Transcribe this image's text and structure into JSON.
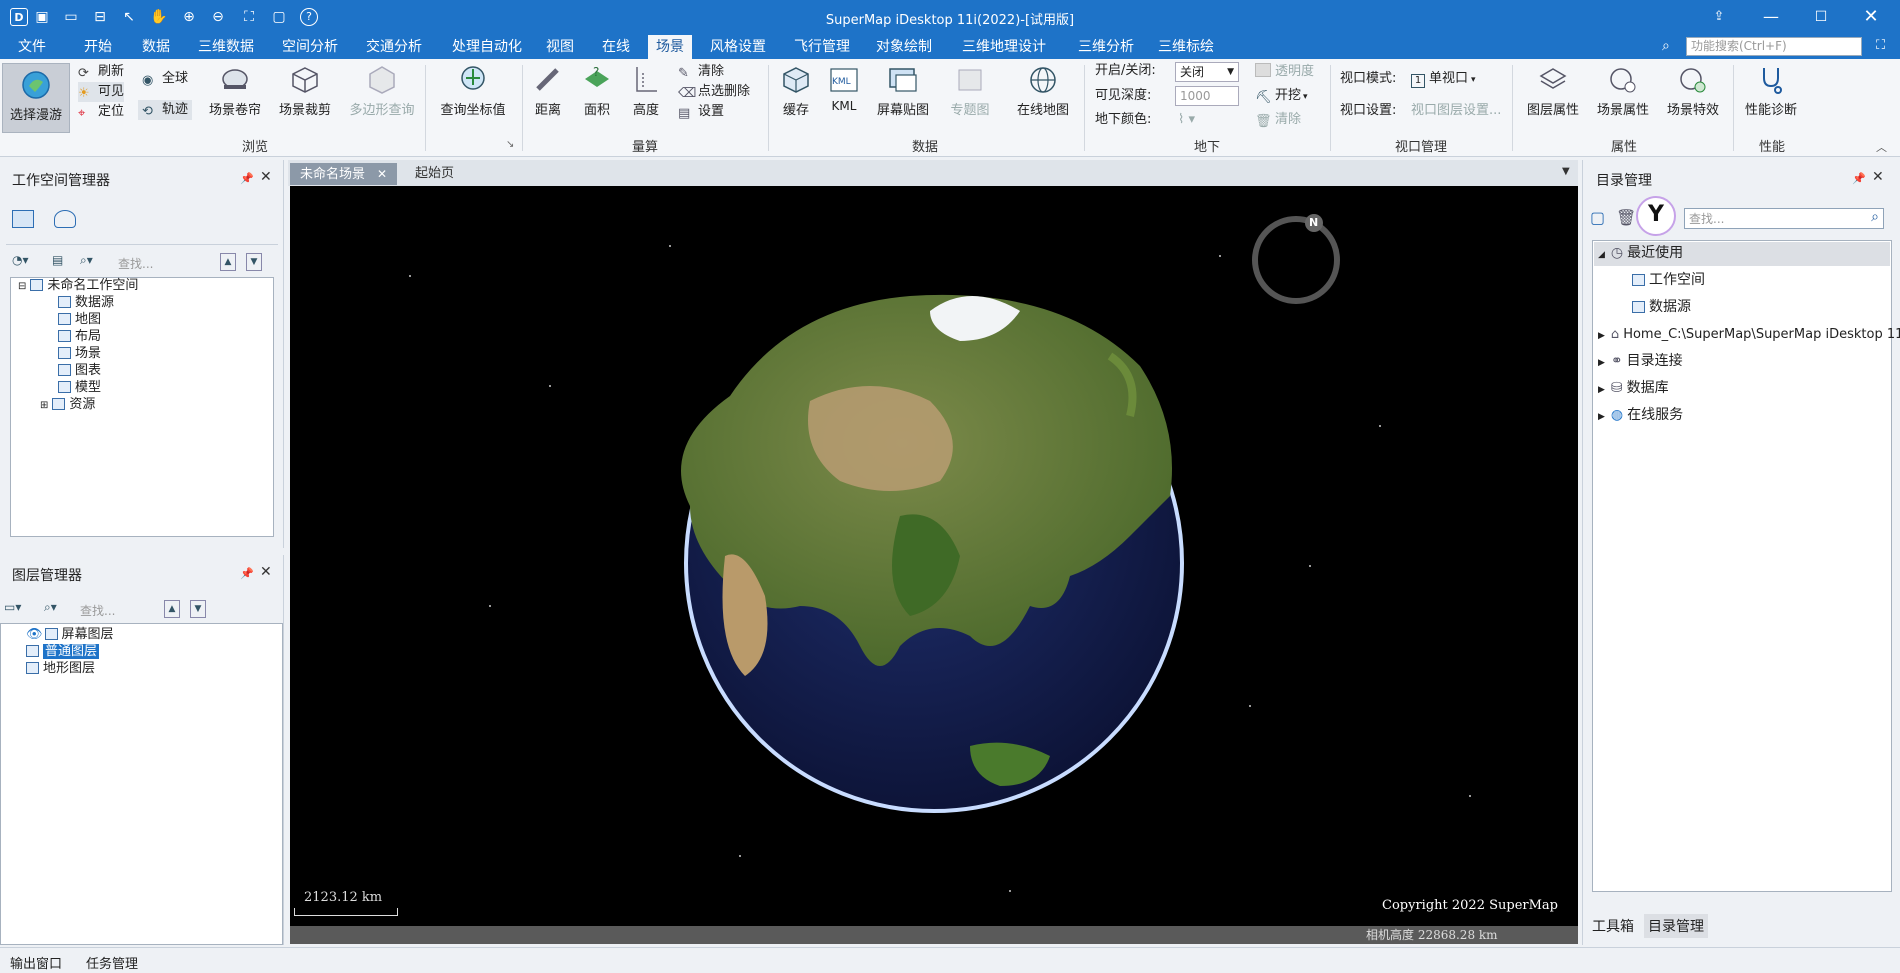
{
  "window": {
    "title": "SuperMap iDesktop 11i(2022)-[试用版]"
  },
  "menubar": {
    "items": [
      "文件",
      "开始",
      "数据",
      "三维数据",
      "空间分析",
      "交通分析",
      "处理自动化",
      "视图",
      "在线",
      "场景",
      "风格设置",
      "飞行管理",
      "对象绘制",
      "三维地理设计",
      "三维分析",
      "三维标绘"
    ],
    "active": "场景",
    "search_placeholder": "功能搜索(Ctrl+F)"
  },
  "ribbon": {
    "browse": {
      "select_roam": "选择漫游",
      "refresh": "刷新",
      "visible": "可见",
      "locate": "定位",
      "global": "全球",
      "track": "轨迹",
      "scene_shutter": "场景卷帘",
      "scene_clip": "场景裁剪",
      "polygon_query": "多边形查询",
      "query_coord": "查询坐标值",
      "group": "浏览"
    },
    "measure": {
      "distance": "距离",
      "area": "面积",
      "height": "高度",
      "clear": "清除",
      "point_delete": "点选删除",
      "settings": "设置",
      "group": "量算"
    },
    "data": {
      "cache": "缓存",
      "kml": "KML",
      "kml_icon": "KML",
      "screen_paste": "屏幕贴图",
      "thematic": "专题图",
      "online_map": "在线地图",
      "group": "数据"
    },
    "underground": {
      "onoff_label": "开启/关闭:",
      "onoff_value": "关闭",
      "depth_label": "可见深度:",
      "depth_value": "1000",
      "color_label": "地下颜色:",
      "transparency": "透明度",
      "excavate": "开挖",
      "clear": "清除",
      "group": "地下"
    },
    "viewport": {
      "mode_label": "视口模式:",
      "mode_value": "单视口",
      "mode_badge": "1",
      "settings_label": "视口设置:",
      "settings_value": "视口图层设置...",
      "group": "视口管理"
    },
    "properties": {
      "layer_prop": "图层属性",
      "scene_prop": "场景属性",
      "scene_effect": "场景特效",
      "group": "属性"
    },
    "performance": {
      "diagnose": "性能诊断",
      "group": "性能"
    }
  },
  "workspace_panel": {
    "title": "工作空间管理器",
    "search_placeholder": "查找...",
    "root": "未命名工作空间",
    "items": [
      "数据源",
      "地图",
      "布局",
      "场景",
      "图表",
      "模型",
      "资源"
    ]
  },
  "layer_panel": {
    "title": "图层管理器",
    "search_placeholder": "查找...",
    "items": [
      "屏幕图层",
      "普通图层",
      "地形图层"
    ]
  },
  "tabs": {
    "scene_tab": "未命名场景",
    "start_tab": "起始页"
  },
  "scene": {
    "scale_text": "2123.12 km",
    "copyright": "Copyright 2022 SuperMap",
    "camera_height": "相机高度 22868.28 km",
    "compass_letter": "N"
  },
  "catalog_panel": {
    "title": "目录管理",
    "search_placeholder": "查找...",
    "recent": "最近使用",
    "recent_items": [
      "工作空间",
      "数据源"
    ],
    "home": "Home_C:\\SuperMap\\SuperMap iDesktop 11...",
    "dir_conn": "目录连接",
    "database": "数据库",
    "online": "在线服务",
    "bottom_tabs": [
      "工具箱",
      "目录管理"
    ]
  },
  "statusbar": {
    "output": "输出窗口",
    "task": "任务管理"
  },
  "colors": {
    "titlebar": "#1e73c8",
    "ribbon": "#f4f6f9",
    "scene_bg": "#000000"
  }
}
